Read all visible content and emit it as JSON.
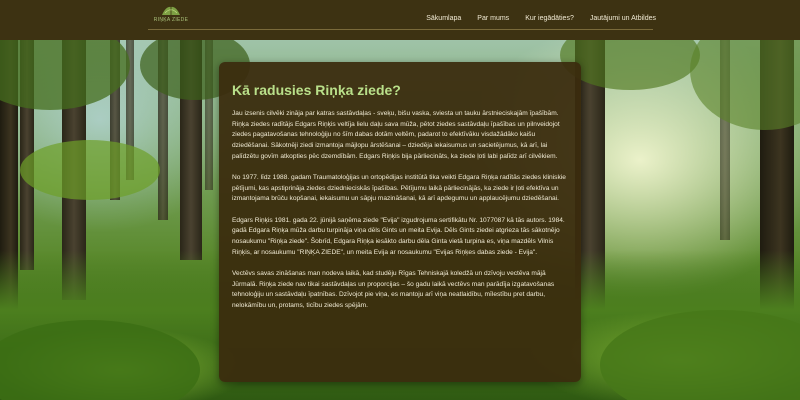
{
  "logo": {
    "text": "RIŅĶA ZIEDE"
  },
  "nav": {
    "items": [
      {
        "label": "Sākumlapa"
      },
      {
        "label": "Par mums"
      },
      {
        "label": "Kur iegādāties?"
      },
      {
        "label": "Jautājumi un Atbildes"
      }
    ]
  },
  "article": {
    "title": "Kā radusies Riņķa ziede?",
    "paragraphs": [
      "Jau izsenis cilvēki zināja par katras sastāvdaļas - sveķu, bišu vaska, sviesta un tauku ārstnieciskajām īpašībām. Riņķa ziedes radītājs Edgars Riņķis veltīja lielu daļu sava mūža, pētot ziedes sastāvdaļu īpašības un pilnveidojot ziedes pagatavošanas tehnoloģiju no šīm dabas dotām veltēm, padarot to efektīvāku visdažādāko kaišu dziedēšanai. Sākotnēji ziedi izmantoja mājlopu ārstēšanai – dziedēja iekaisumus un sacietējumus, kā arī, lai palīdzētu govīm atkopties pēc dzemdībām. Edgars Riņķis bija pārliecināts, ka ziede ļoti labi palīdz arī cilvēkiem.",
      "No 1977. līdz 1988. gadam Traumatoloģijas un ortopēdijas institūtā tika veikti Edgara Riņķa radītās ziedes kliniskie pētījumi, kas apstiprināja ziedes dziednieciskās īpašības. Pētījumu laikā pārliecinājās, ka ziede ir ļoti efektīva un izmantojama brūču kopšanai, iekaisumu un sāpju mazināšanai, kā arī apdegumu un applaucējumu dziedēšanai.",
      "Edgars Riņķis 1981. gada 22. jūnijā saņēma ziede \"Evija\" izgudrojuma sertifikātu Nr. 1077087 kā tās autors. 1984. gadā Edgara Riņķa mūža darbu turpināja viņa dēls Gints un meita Evija. Dēls Gints ziedei atgrieza tās sākotnējo nosaukumu \"Riņķa ziede\". Šobrīd, Edgara Riņķa iesākto darbu dēla Ginta vietā turpina es, viņa mazdēls Vilnis Riņķis, ar nosaukumu \"RIŅĶA ZIEDE\", un meita Evija ar nosaukumu \"Evijas Riņķes dabas ziede - Evija\".",
      "Vectēvs savas zināšanas man nodeva laikā, kad studēju Rīgas Tehniskajā koledžā un dzīvoju vectēva mājā Jūrmalā. Riņķa ziede nav tikai sastāvdaļas un proporcijas – šo gadu laikā vectēvs man parādīja izgatavošanas tehnoloģiju un sastāvdaļu īpatnības. Dzīvojot pie viņa, es mantoju arī viņa neatlaidību, mīlestību pret darbu, nelokāmību un, protams, ticību ziedes spējām."
    ]
  },
  "colors": {
    "header_bg": "#3d3212",
    "card_bg": "#3a2c0e",
    "title": "#b9e08a",
    "body_text": "#f2ecd6"
  }
}
